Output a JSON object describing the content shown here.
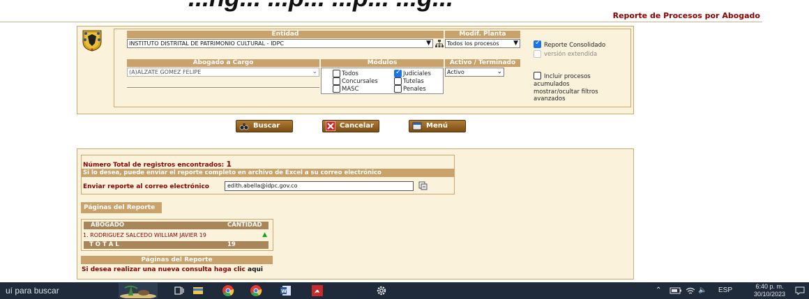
{
  "page": {
    "top_title": "...ng... ...p... ...p... ...g...",
    "report_title": "Reporte de Procesos por Abogado"
  },
  "filters": {
    "entidad_header": "Entidad",
    "entidad_value": "INSTITUTO DISTRITAL DE PATRIMONIO CULTURAL - IDPC",
    "modif_header": "Modif. Planta",
    "modif_value": "Todos los procesos",
    "reporte_consolidado": "Reporte Consolidado",
    "version_extendida": "versión extendida",
    "abogado_header": "Abogado a Cargo",
    "abogado_value": "(A)ALZATE GOMEZ FELIPE",
    "modulos_header": "Módulos",
    "modulos": {
      "todos": "Todos",
      "judiciales": "Judiciales",
      "concursales": "Concursales",
      "tutelas": "Tutelas",
      "masc": "MASC",
      "penales": "Penales"
    },
    "activo_header": "Activo / Terminado",
    "activo_value": "Activo",
    "incluir_procesos": "Incluir procesos",
    "acumulados": "acumulados",
    "mostrar_filtros": "mostrar/ocultar filtros",
    "avanzados": "avanzados"
  },
  "buttons": {
    "buscar": "Buscar",
    "cancelar": "Cancelar",
    "menu": "Menú"
  },
  "results": {
    "total_label": "Número Total de registros encontrados:",
    "total_value": "1",
    "excel_note": "Si lo desea, puede enviar el reporte completo en archivo de Excel a su correo electrónico",
    "email_label": "Enviar reporte al correo electrónico",
    "email_value": "edith.abella@idpc.gov.co",
    "paginas_label": "Páginas del Reporte",
    "table": {
      "col_abogado": "ABOGADO",
      "col_cantidad": "CANTIDAD",
      "row_name": "1. RODRIGUEZ SALCEDO WILLIAM JAVIER",
      "row_value": "19",
      "total_label": "T O T A L",
      "total_value": "19"
    },
    "paginas_bottom": "Páginas del Reporte",
    "new_query": "Si desea realizar una nueva consulta haga clic",
    "new_query_link": "aqui"
  },
  "taskbar": {
    "search_text": "uí para buscar",
    "lang": "ESP",
    "time": "6:40 p. m.",
    "date": "30/10/2023"
  },
  "colors": {
    "header_tan": "#c9a16b",
    "dark_red": "#8b0000",
    "panel_bg": "#fbf2dc",
    "button_brown": "#8a5a1e"
  }
}
